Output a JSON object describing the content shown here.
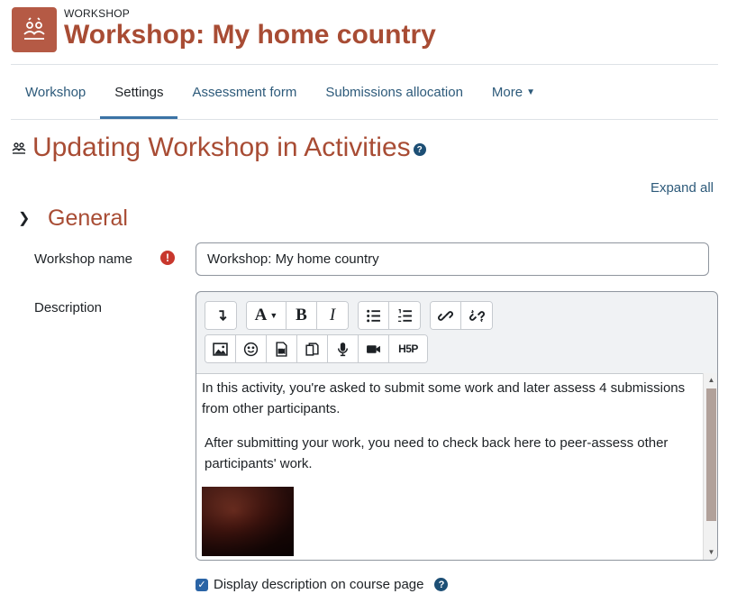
{
  "header": {
    "activity_type": "WORKSHOP",
    "title": "Workshop: My home country",
    "icon": "workshop-icon",
    "accent_color": "#a84c34"
  },
  "nav": {
    "tabs": [
      {
        "label": "Workshop"
      },
      {
        "label": "Settings",
        "active": true
      },
      {
        "label": "Assessment form"
      },
      {
        "label": "Submissions allocation"
      },
      {
        "label": "More"
      }
    ]
  },
  "page": {
    "heading": "Updating Workshop in Activities",
    "help_icon": "help-icon",
    "expand_all": "Expand all"
  },
  "section": {
    "title": "General",
    "expanded": true
  },
  "form": {
    "name_label": "Workshop name",
    "name_value": "Workshop: My home country",
    "name_required_icon": "required-icon",
    "description_label": "Description",
    "editor": {
      "toolbar_row1": [
        "more-toggle-icon",
        "font-icon",
        "bold-icon",
        "italic-icon",
        "unordered-list-icon",
        "ordered-list-icon",
        "link-icon",
        "unlink-icon"
      ],
      "toolbar_row2": [
        "image-icon",
        "emoji-icon",
        "media-icon",
        "manage-files-icon",
        "record-audio-icon",
        "record-video-icon",
        "h5p-icon"
      ],
      "bold": "B",
      "italic": "I",
      "font": "A",
      "h5p": "H5P",
      "paragraph1": "In this activity, you're asked to submit some work and later assess 4 submissions from other participants.",
      "paragraph2": "After submitting your work, you need to check back here  to peer-assess other participants' work."
    },
    "display_description_label": "Display description on course page",
    "display_description_checked": true
  }
}
